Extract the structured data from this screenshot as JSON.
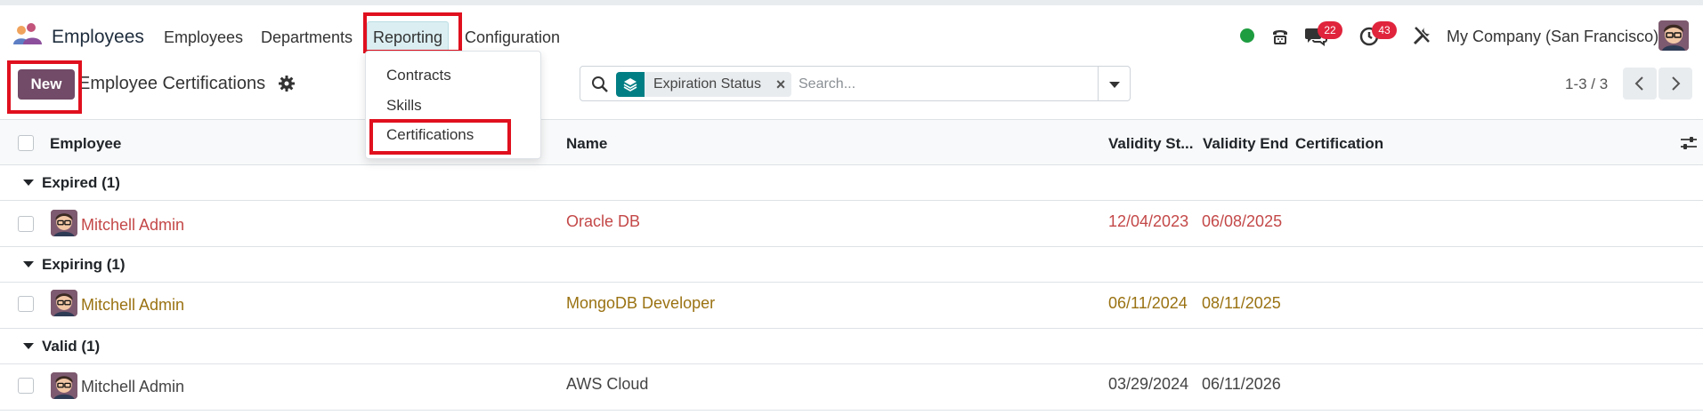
{
  "navbar": {
    "app_name": "Employees",
    "menu": {
      "employees": "Employees",
      "departments": "Departments",
      "reporting": "Reporting",
      "configuration": "Configuration"
    },
    "status_color": "#1e9c40",
    "messages_badge": "22",
    "activities_badge": "43",
    "company": "My Company (San Francisco)"
  },
  "reporting_menu": {
    "items": [
      "Contracts",
      "Skills",
      "Certifications"
    ]
  },
  "control_panel": {
    "new_label": "New",
    "breadcrumb": "Employee Certifications",
    "search": {
      "facet": "Expiration Status",
      "placeholder": "Search..."
    },
    "pager": "1-3 / 3"
  },
  "list": {
    "columns": {
      "employee": "Employee",
      "name": "Name",
      "validity_start": "Validity St...",
      "validity_end": "Validity End",
      "certification": "Certification"
    },
    "groups": [
      {
        "label": "Expired (1)",
        "color": "#c44848",
        "row": {
          "employee": "Mitchell Admin",
          "name": "Oracle DB",
          "start": "12/04/2023",
          "end": "06/08/2025",
          "certification": ""
        }
      },
      {
        "label": "Expiring (1)",
        "color": "#9a7212",
        "row": {
          "employee": "Mitchell Admin",
          "name": "MongoDB Developer",
          "start": "06/11/2024",
          "end": "08/11/2025",
          "certification": ""
        }
      },
      {
        "label": "Valid (1)",
        "color": "#444444",
        "row": {
          "employee": "Mitchell Admin",
          "name": "AWS Cloud",
          "start": "03/29/2024",
          "end": "06/11/2026",
          "certification": ""
        }
      }
    ]
  },
  "colors": {
    "brand": "#714b67",
    "facet": "#017e84",
    "highlight": "#e0101e",
    "badge": "#e0243c"
  }
}
